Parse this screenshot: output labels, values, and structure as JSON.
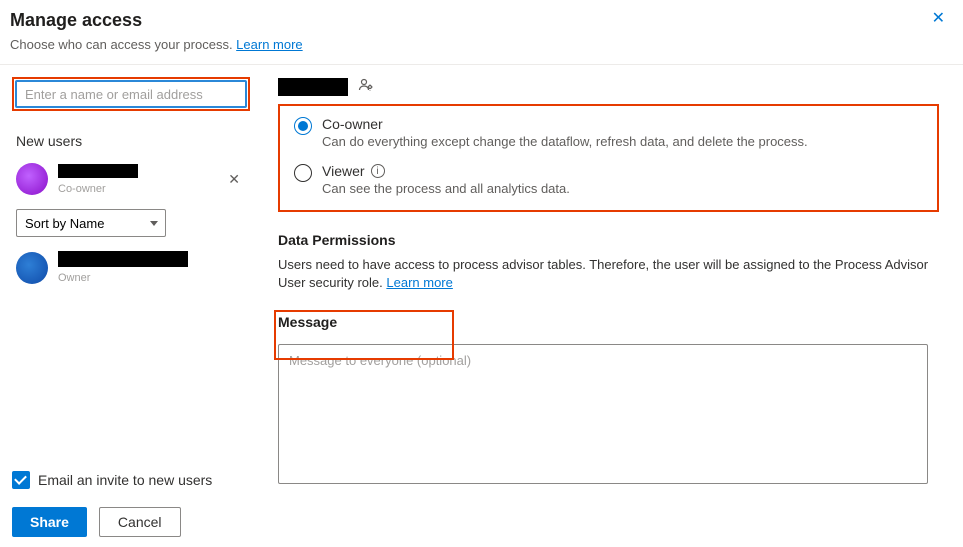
{
  "header": {
    "title": "Manage access",
    "subtitle_prefix": "Choose who can access your process. ",
    "learn_more": "Learn more"
  },
  "left": {
    "search_placeholder": "Enter a name or email address",
    "new_users_label": "New users",
    "new_user": {
      "role": "Co-owner"
    },
    "sort_label": "Sort by Name",
    "existing_user": {
      "role": "Owner"
    }
  },
  "right": {
    "roles": {
      "coowner": {
        "title": "Co-owner",
        "desc": "Can do everything except change the dataflow, refresh data, and delete the process."
      },
      "viewer": {
        "title": "Viewer",
        "desc": "Can see the process and all analytics data."
      }
    },
    "data_perm": {
      "heading": "Data Permissions",
      "text_prefix": "Users need to have access to process advisor tables. Therefore, the user will be assigned to the Process Advisor User security role. ",
      "learn_more": "Learn more"
    },
    "message": {
      "heading": "Message",
      "placeholder": "Message to everyone (optional)"
    }
  },
  "footer": {
    "email_invite": "Email an invite to new users",
    "share": "Share",
    "cancel": "Cancel"
  }
}
